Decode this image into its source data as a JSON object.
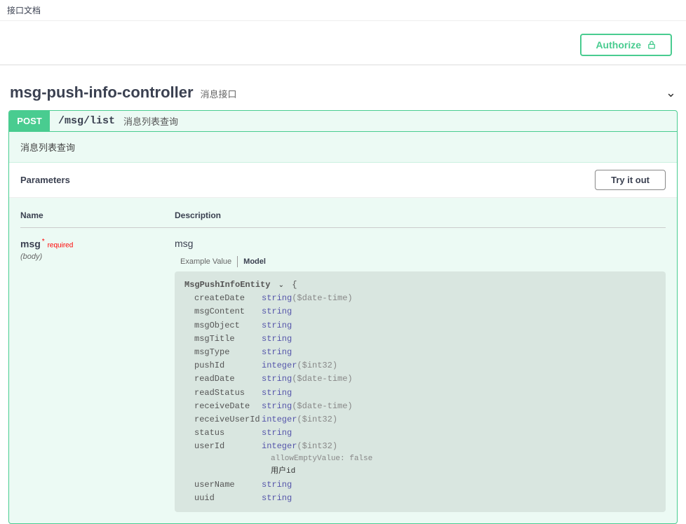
{
  "topbar": {
    "label": "接口文档"
  },
  "authorize": {
    "label": "Authorize"
  },
  "controller": {
    "name": "msg-push-info-controller",
    "desc": "消息接口"
  },
  "operation": {
    "method": "POST",
    "path": "/msg/list",
    "summary": "消息列表查询",
    "desc": "消息列表查询"
  },
  "params_bar": {
    "title": "Parameters",
    "tryout": "Try it out"
  },
  "param_headers": {
    "name": "Name",
    "desc": "Description"
  },
  "param": {
    "name": "msg",
    "required_star": "*",
    "required_text": "required",
    "in": "(body)",
    "desc": "msg"
  },
  "tabs": {
    "example": "Example Value",
    "model": "Model"
  },
  "model": {
    "title": "MsgPushInfoEntity",
    "open": "{",
    "props": [
      {
        "name": "createDate",
        "type": "string",
        "fmt": "($date-time)"
      },
      {
        "name": "msgContent",
        "type": "string",
        "fmt": ""
      },
      {
        "name": "msgObject",
        "type": "string",
        "fmt": ""
      },
      {
        "name": "msgTitle",
        "type": "string",
        "fmt": ""
      },
      {
        "name": "msgType",
        "type": "string",
        "fmt": ""
      },
      {
        "name": "pushId",
        "type": "integer",
        "fmt": "($int32)"
      },
      {
        "name": "readDate",
        "type": "string",
        "fmt": "($date-time)"
      },
      {
        "name": "readStatus",
        "type": "string",
        "fmt": ""
      },
      {
        "name": "receiveDate",
        "type": "string",
        "fmt": "($date-time)"
      },
      {
        "name": "receiveUserId",
        "type": "integer",
        "fmt": "($int32)"
      },
      {
        "name": "status",
        "type": "string",
        "fmt": ""
      },
      {
        "name": "userId",
        "type": "integer",
        "fmt": "($int32)",
        "extra": "allowEmptyValue: false",
        "text": "用户id"
      },
      {
        "name": "userName",
        "type": "string",
        "fmt": ""
      },
      {
        "name": "uuid",
        "type": "string",
        "fmt": ""
      }
    ]
  }
}
